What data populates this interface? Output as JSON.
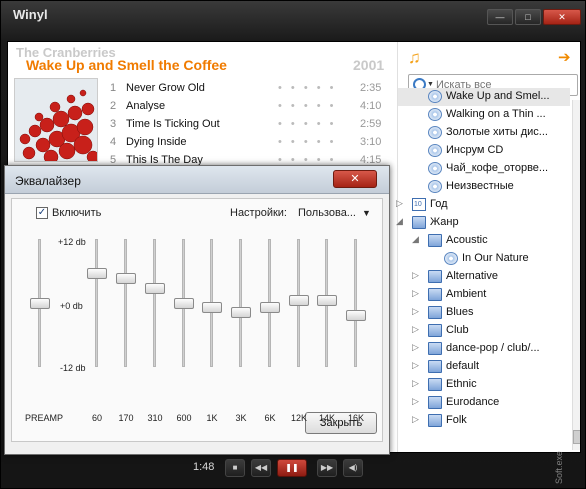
{
  "window": {
    "title": "Winyl",
    "buttons": {
      "minimize": "—",
      "maximize": "□",
      "close": "✕"
    }
  },
  "album": {
    "artist": "The Cranberries",
    "title": "Wake Up and Smell the Coffee",
    "year": "2001",
    "tracks": [
      {
        "num": "1",
        "name": "Never Grow Old",
        "dur": "2:35"
      },
      {
        "num": "2",
        "name": "Analyse",
        "dur": "4:10"
      },
      {
        "num": "3",
        "name": "Time Is Ticking Out",
        "dur": "2:59"
      },
      {
        "num": "4",
        "name": "Dying Inside",
        "dur": "3:10"
      },
      {
        "num": "5",
        "name": "This Is The Day",
        "dur": "4:15"
      }
    ],
    "rating_dots": "• • • • •"
  },
  "library": {
    "search_placeholder": "Искать все",
    "tree": [
      {
        "label": "Wake Up and Smel...",
        "icon": "disc-icon",
        "level": 1,
        "selected": true
      },
      {
        "label": "Walking on a Thin ...",
        "icon": "disc-icon",
        "level": 1
      },
      {
        "label": "Золотые хиты дис...",
        "icon": "disc-icon",
        "level": 1
      },
      {
        "label": "Инсрум CD",
        "icon": "disc-icon",
        "level": 1
      },
      {
        "label": "Чай_кофе_оторве...",
        "icon": "disc-icon",
        "level": 1
      },
      {
        "label": "Неизвестные",
        "icon": "disc-icon",
        "level": 1
      },
      {
        "label": "Год",
        "icon": "calendar-icon",
        "level": 0,
        "expander": "▷"
      },
      {
        "label": "Жанр",
        "icon": "folder-icon",
        "level": 0,
        "expander": "◢"
      },
      {
        "label": "Acoustic",
        "icon": "folder-icon",
        "level": 1,
        "expander": "◢"
      },
      {
        "label": "In Our Nature",
        "icon": "disc-icon",
        "level": 2
      },
      {
        "label": "Alternative",
        "icon": "folder-icon",
        "level": 1,
        "expander": "▷"
      },
      {
        "label": "Ambient",
        "icon": "folder-icon",
        "level": 1,
        "expander": "▷"
      },
      {
        "label": "Blues",
        "icon": "folder-icon",
        "level": 1,
        "expander": "▷"
      },
      {
        "label": "Club",
        "icon": "folder-icon",
        "level": 1,
        "expander": "▷"
      },
      {
        "label": "dance-pop / club/...",
        "icon": "folder-icon",
        "level": 1,
        "expander": "▷"
      },
      {
        "label": "default",
        "icon": "folder-icon",
        "level": 1,
        "expander": "▷"
      },
      {
        "label": "Ethnic",
        "icon": "folder-icon",
        "level": 1,
        "expander": "▷"
      },
      {
        "label": "Eurodance",
        "icon": "folder-icon",
        "level": 1,
        "expander": "▷"
      },
      {
        "label": "Folk",
        "icon": "folder-icon",
        "level": 1,
        "expander": "▷"
      }
    ]
  },
  "player": {
    "time": "1:48",
    "controls": {
      "stop": "■",
      "prev": "◀◀",
      "pause": "❚❚",
      "next": "▶▶",
      "volume": "◀)"
    }
  },
  "equalizer": {
    "title": "Эквалайзер",
    "close_label": "✕",
    "enable_label": "Включить",
    "enabled": true,
    "checkmark": "✓",
    "settings_label": "Настройки:",
    "preset_value": "Пользова...",
    "preset_caret": "▼",
    "db_labels": {
      "max": "+12 db",
      "zero": "+0 db",
      "min": "-12 db"
    },
    "preamp": {
      "label": "PREAMP",
      "gain_db": 0
    },
    "bands": [
      {
        "label": "60",
        "gain_db": 6
      },
      {
        "label": "170",
        "gain_db": 5
      },
      {
        "label": "310",
        "gain_db": 3
      },
      {
        "label": "600",
        "gain_db": 0
      },
      {
        "label": "1K",
        "gain_db": -1
      },
      {
        "label": "3K",
        "gain_db": -2
      },
      {
        "label": "6K",
        "gain_db": -1
      },
      {
        "label": "12K",
        "gain_db": 0.5
      },
      {
        "label": "14K",
        "gain_db": 0.5
      },
      {
        "label": "16K",
        "gain_db": -2.5
      }
    ],
    "close_button": "Закрыть"
  },
  "watermark": "Soft.exe"
}
